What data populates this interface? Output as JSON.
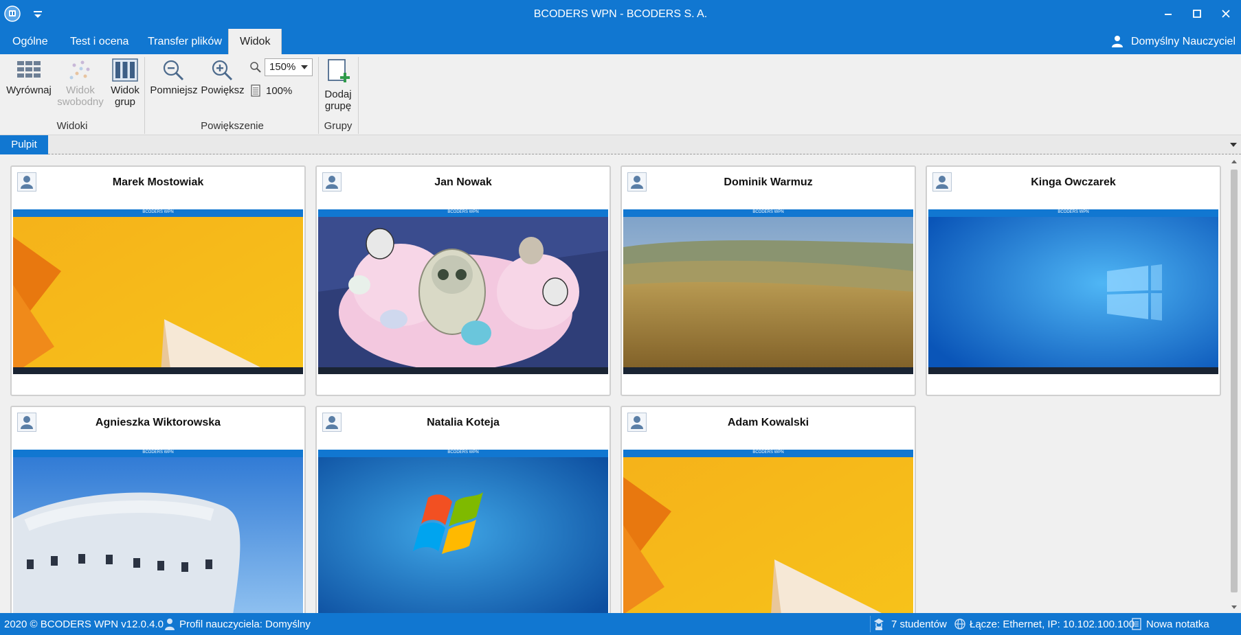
{
  "window": {
    "title": "BCODERS WPN - BCODERS S. A."
  },
  "menu": {
    "tabs": [
      {
        "label": "Ogólne"
      },
      {
        "label": "Test i ocena"
      },
      {
        "label": "Transfer plików"
      },
      {
        "label": "Widok"
      }
    ],
    "active_tab": "Widok",
    "user": "Domyślny Nauczyciel"
  },
  "ribbon": {
    "views": {
      "label": "Widoki",
      "align": "Wyrównaj",
      "free_view_line1": "Widok",
      "free_view_line2": "swobodny",
      "group_view_line1": "Widok",
      "group_view_line2": "grup"
    },
    "zoom": {
      "label": "Powiększenie",
      "zoom_out": "Pomniejsz",
      "zoom_in": "Powiększ",
      "zoom_value": "150%",
      "zoom_reset": "100%"
    },
    "groups": {
      "label": "Grupy",
      "add_line1": "Dodaj",
      "add_line2": "grupę"
    }
  },
  "document_tab": "Pulpit",
  "students": [
    {
      "name": "Marek Mostowiak",
      "wallpaper": "win8-orange"
    },
    {
      "name": "Jan Nowak",
      "wallpaper": "cartoon-pink"
    },
    {
      "name": "Dominik Warmuz",
      "wallpaper": "field-landscape"
    },
    {
      "name": "Kinga Owczarek",
      "wallpaper": "win10-blue"
    },
    {
      "name": "Agnieszka Wiktorowska",
      "wallpaper": "white-building"
    },
    {
      "name": "Natalia Koteja",
      "wallpaper": "win7-blue"
    },
    {
      "name": "Adam Kowalski",
      "wallpaper": "win8-orange"
    }
  ],
  "screen_mini_title": "BCODERS WPN",
  "status": {
    "copyright": "2020 ©  BCODERS WPN v12.0.4.0",
    "profile": "Profil nauczyciela: Domyślny",
    "students_count": "7 studentów",
    "connection": "Łącze: Ethernet, IP: 10.102.100.100",
    "note": "Nowa notatka"
  },
  "colors": {
    "accent": "#1177d1",
    "ribbon_bg": "#f0f0f0"
  }
}
